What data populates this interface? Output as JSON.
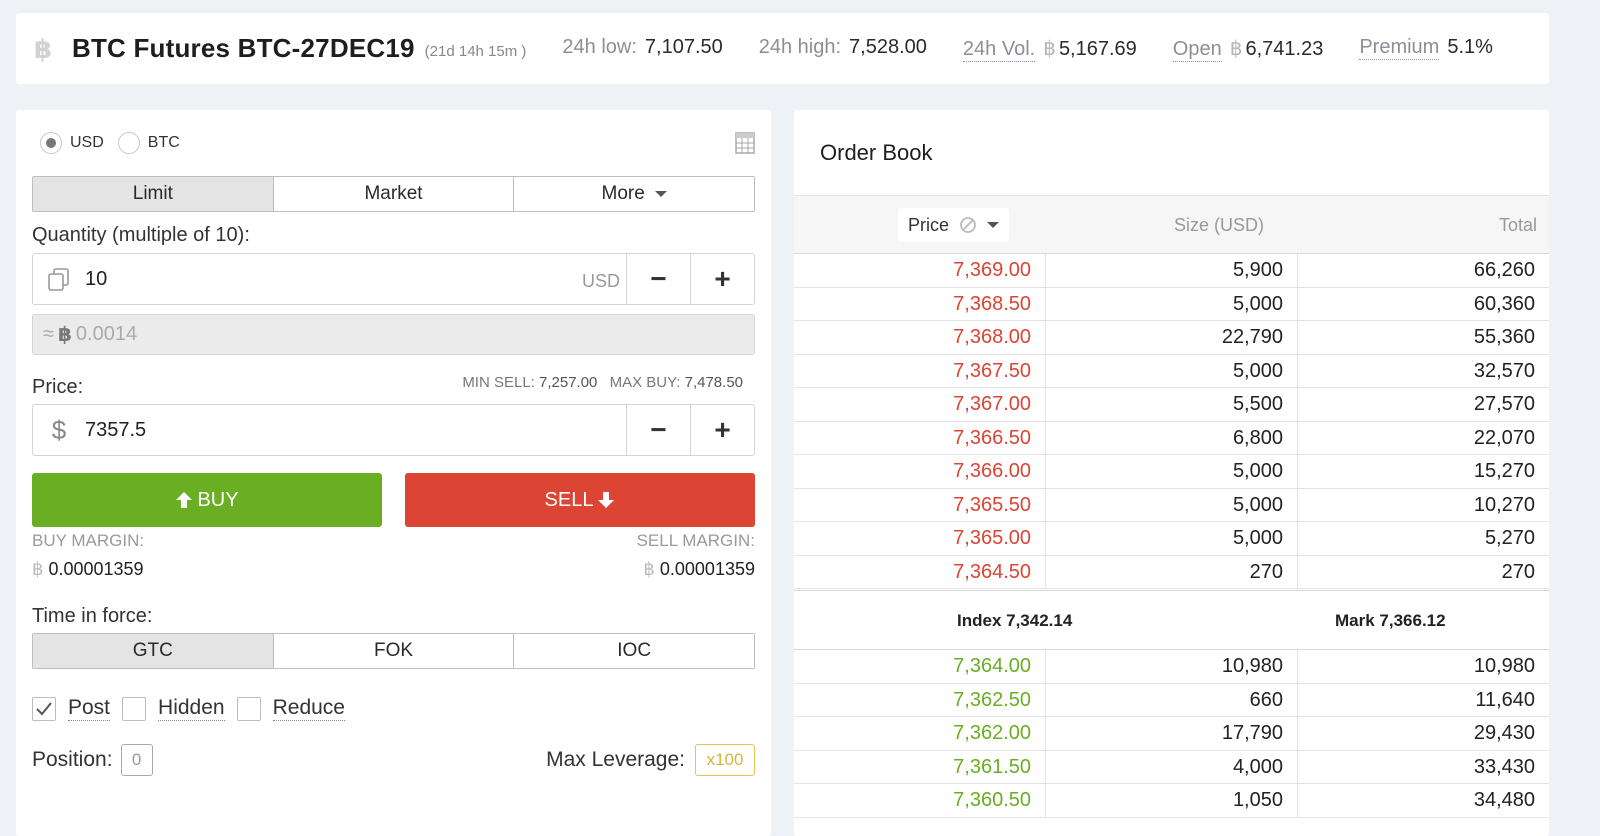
{
  "header": {
    "title": "BTC Futures BTC-27DEC19",
    "expiry": "(21d 14h 15m )",
    "stats": [
      {
        "label": "24h low:",
        "value": "7,107.50",
        "btc": false,
        "dotted": false
      },
      {
        "label": "24h high:",
        "value": "7,528.00",
        "btc": false,
        "dotted": false
      },
      {
        "label": "24h Vol.",
        "value": "5,167.69",
        "btc": true,
        "dotted": true
      },
      {
        "label": "Open",
        "value": "6,741.23",
        "btc": true,
        "dotted": true
      },
      {
        "label": "Premium",
        "value": "5.1%",
        "btc": false,
        "dotted": true
      }
    ]
  },
  "order_form": {
    "currency_options": [
      "USD",
      "BTC"
    ],
    "currency_selected": "USD",
    "order_types": [
      "Limit",
      "Market",
      "More"
    ],
    "order_type_selected": "Limit",
    "quantity_label": "Quantity (multiple of 10):",
    "quantity_value": "10",
    "quantity_unit": "USD",
    "approx_prefix": "≈",
    "approx_btc_symbol": "฿",
    "approx_value": "0.0014",
    "price_label": "Price:",
    "min_sell_label": "MIN SELL:",
    "min_sell_value": "7,257.00",
    "max_buy_label": "MAX BUY:",
    "max_buy_value": "7,478.50",
    "price_value": "7357.5",
    "minus": "−",
    "plus": "+",
    "buy_label": "BUY",
    "sell_label": "SELL",
    "buy_margin_label": "BUY MARGIN:",
    "buy_margin_value": "0.00001359",
    "sell_margin_label": "SELL MARGIN:",
    "sell_margin_value": "0.00001359",
    "tif_label": "Time in force:",
    "tif_options": [
      "GTC",
      "FOK",
      "IOC"
    ],
    "tif_selected": "GTC",
    "checkboxes": [
      {
        "label": "Post",
        "checked": true
      },
      {
        "label": "Hidden",
        "checked": false
      },
      {
        "label": "Reduce",
        "checked": false
      }
    ],
    "position_label": "Position:",
    "position_value": "0",
    "max_leverage_label": "Max Leverage:",
    "max_leverage_value": "x100"
  },
  "order_book": {
    "title": "Order Book",
    "col_price": "Price",
    "col_size": "Size (USD)",
    "col_total": "Total",
    "asks": [
      {
        "price": "7,369.00",
        "size": "5,900",
        "total": "66,260"
      },
      {
        "price": "7,368.50",
        "size": "5,000",
        "total": "60,360"
      },
      {
        "price": "7,368.00",
        "size": "22,790",
        "total": "55,360"
      },
      {
        "price": "7,367.50",
        "size": "5,000",
        "total": "32,570"
      },
      {
        "price": "7,367.00",
        "size": "5,500",
        "total": "27,570"
      },
      {
        "price": "7,366.50",
        "size": "6,800",
        "total": "22,070"
      },
      {
        "price": "7,366.00",
        "size": "5,000",
        "total": "15,270"
      },
      {
        "price": "7,365.50",
        "size": "5,000",
        "total": "10,270"
      },
      {
        "price": "7,365.00",
        "size": "5,000",
        "total": "5,270"
      },
      {
        "price": "7,364.50",
        "size": "270",
        "total": "270"
      }
    ],
    "index_text": "Index 7,342.14",
    "mark_text": "Mark  7,366.12",
    "bids": [
      {
        "price": "7,364.00",
        "size": "10,980",
        "total": "10,980"
      },
      {
        "price": "7,362.50",
        "size": "660",
        "total": "11,640"
      },
      {
        "price": "7,362.00",
        "size": "17,790",
        "total": "29,430"
      },
      {
        "price": "7,361.50",
        "size": "4,000",
        "total": "33,430"
      },
      {
        "price": "7,360.50",
        "size": "1,050",
        "total": "34,480"
      }
    ]
  },
  "colors": {
    "buy": "#6aae24",
    "sell": "#dc4433",
    "leverage": "#d8b43a"
  }
}
